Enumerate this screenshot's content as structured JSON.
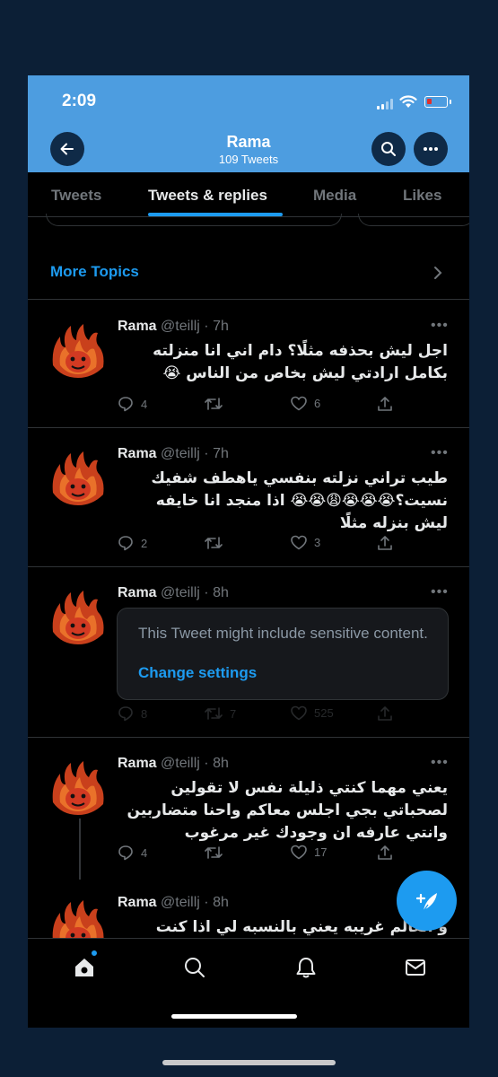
{
  "status_bar": {
    "time": "2:09"
  },
  "header": {
    "title": "Rama",
    "subtitle": "109 Tweets"
  },
  "tabs": [
    {
      "label": "Tweets"
    },
    {
      "label": "Tweets & replies"
    },
    {
      "label": "Media"
    },
    {
      "label": "Likes"
    }
  ],
  "active_tab": "Tweets & replies",
  "topics": {
    "label": "More Topics"
  },
  "tweets": [
    {
      "name": "Rama",
      "handle": "@teillj",
      "time": "· 7h",
      "text": "اجل ليش بحذفه مثلًا؟ دام اني انا منزلته بكامل ارادتي ليش بخاص من الناس 😭",
      "replies": "4",
      "likes": "6"
    },
    {
      "name": "Rama",
      "handle": "@teillj",
      "time": "· 7h",
      "text": "طيب تراني نزلته بنفسي ياهطف شفيك نسيت؟😭😭😭😩😭😭 اذا منجد انا خايفه ليش بنزله مثلًا",
      "replies": "2",
      "likes": "3"
    },
    {
      "name": "Rama",
      "handle": "@teillj",
      "time": "· 8h",
      "sensitive_text": "This Tweet might include sensitive content.",
      "sensitive_link": "Change settings",
      "replies": "8",
      "retweets": "7",
      "likes": "525"
    },
    {
      "name": "Rama",
      "handle": "@teillj",
      "time": "· 8h",
      "text": "يعني مهما كنتي ذليلة نفس لا تقولين لصحباتي بجي اجلس معاكم واحنا متضاربين وانتي عارفه ان وجودك غير مرغوب",
      "replies": "4",
      "likes": "17"
    },
    {
      "name": "Rama",
      "handle": "@teillj",
      "time": "· 8h",
      "text": "و العالم غريبه يعني بالنسبه لي اذا كنت"
    }
  ],
  "colors": {
    "accent": "#1d9bf0",
    "header_bg": "#4d9de0",
    "background": "#000000"
  }
}
